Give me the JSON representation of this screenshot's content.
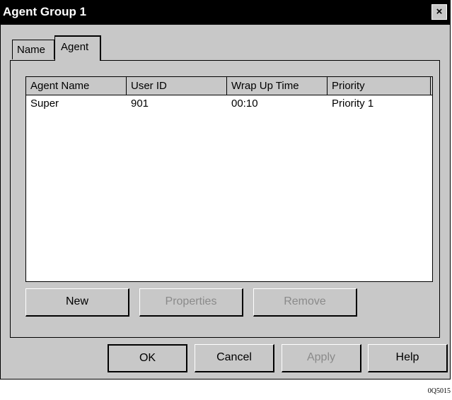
{
  "window": {
    "title": "Agent Group 1",
    "close_label": "×"
  },
  "tabs": [
    {
      "label": "Name"
    },
    {
      "label": "Agent"
    }
  ],
  "table": {
    "columns": [
      "Agent Name",
      "User ID",
      "Wrap Up Time",
      "Priority"
    ],
    "rows": [
      [
        "Super",
        "901",
        "00:10",
        "Priority 1"
      ]
    ]
  },
  "panel_buttons": {
    "new": "New",
    "properties": "Properties",
    "remove": "Remove"
  },
  "footer_buttons": {
    "ok": "OK",
    "cancel": "Cancel",
    "apply": "Apply",
    "help": "Help"
  },
  "figure_id": "0Q5015"
}
